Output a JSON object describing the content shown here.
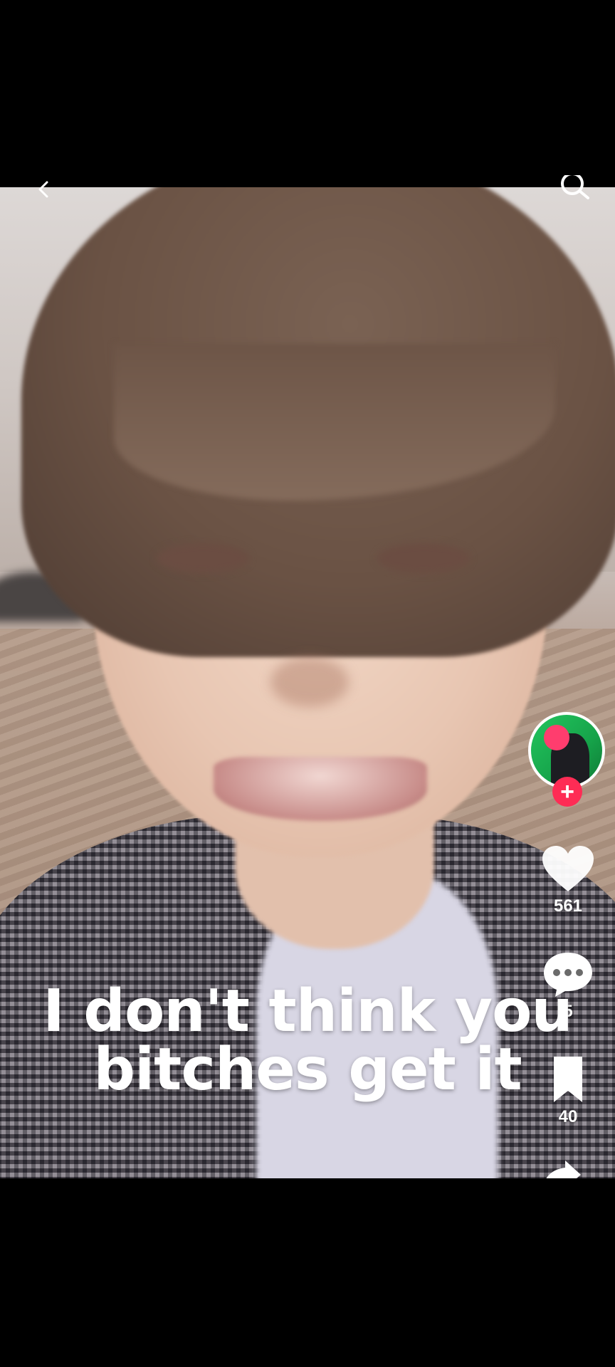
{
  "video": {
    "caption_lines": [
      "I don't think you",
      "bitches get it"
    ]
  },
  "sidebar": {
    "follow_label": "+",
    "likes_count": "561",
    "comments_count": "5",
    "saves_count": "40"
  },
  "icons": {
    "back": "back-arrow-icon",
    "search": "search-icon",
    "like": "heart-icon",
    "comment": "comment-bubble-icon",
    "save": "bookmark-icon",
    "share": "share-arrow-icon"
  },
  "colors": {
    "accent": "#fe2c55",
    "avatar_bg": "#22c55e"
  }
}
